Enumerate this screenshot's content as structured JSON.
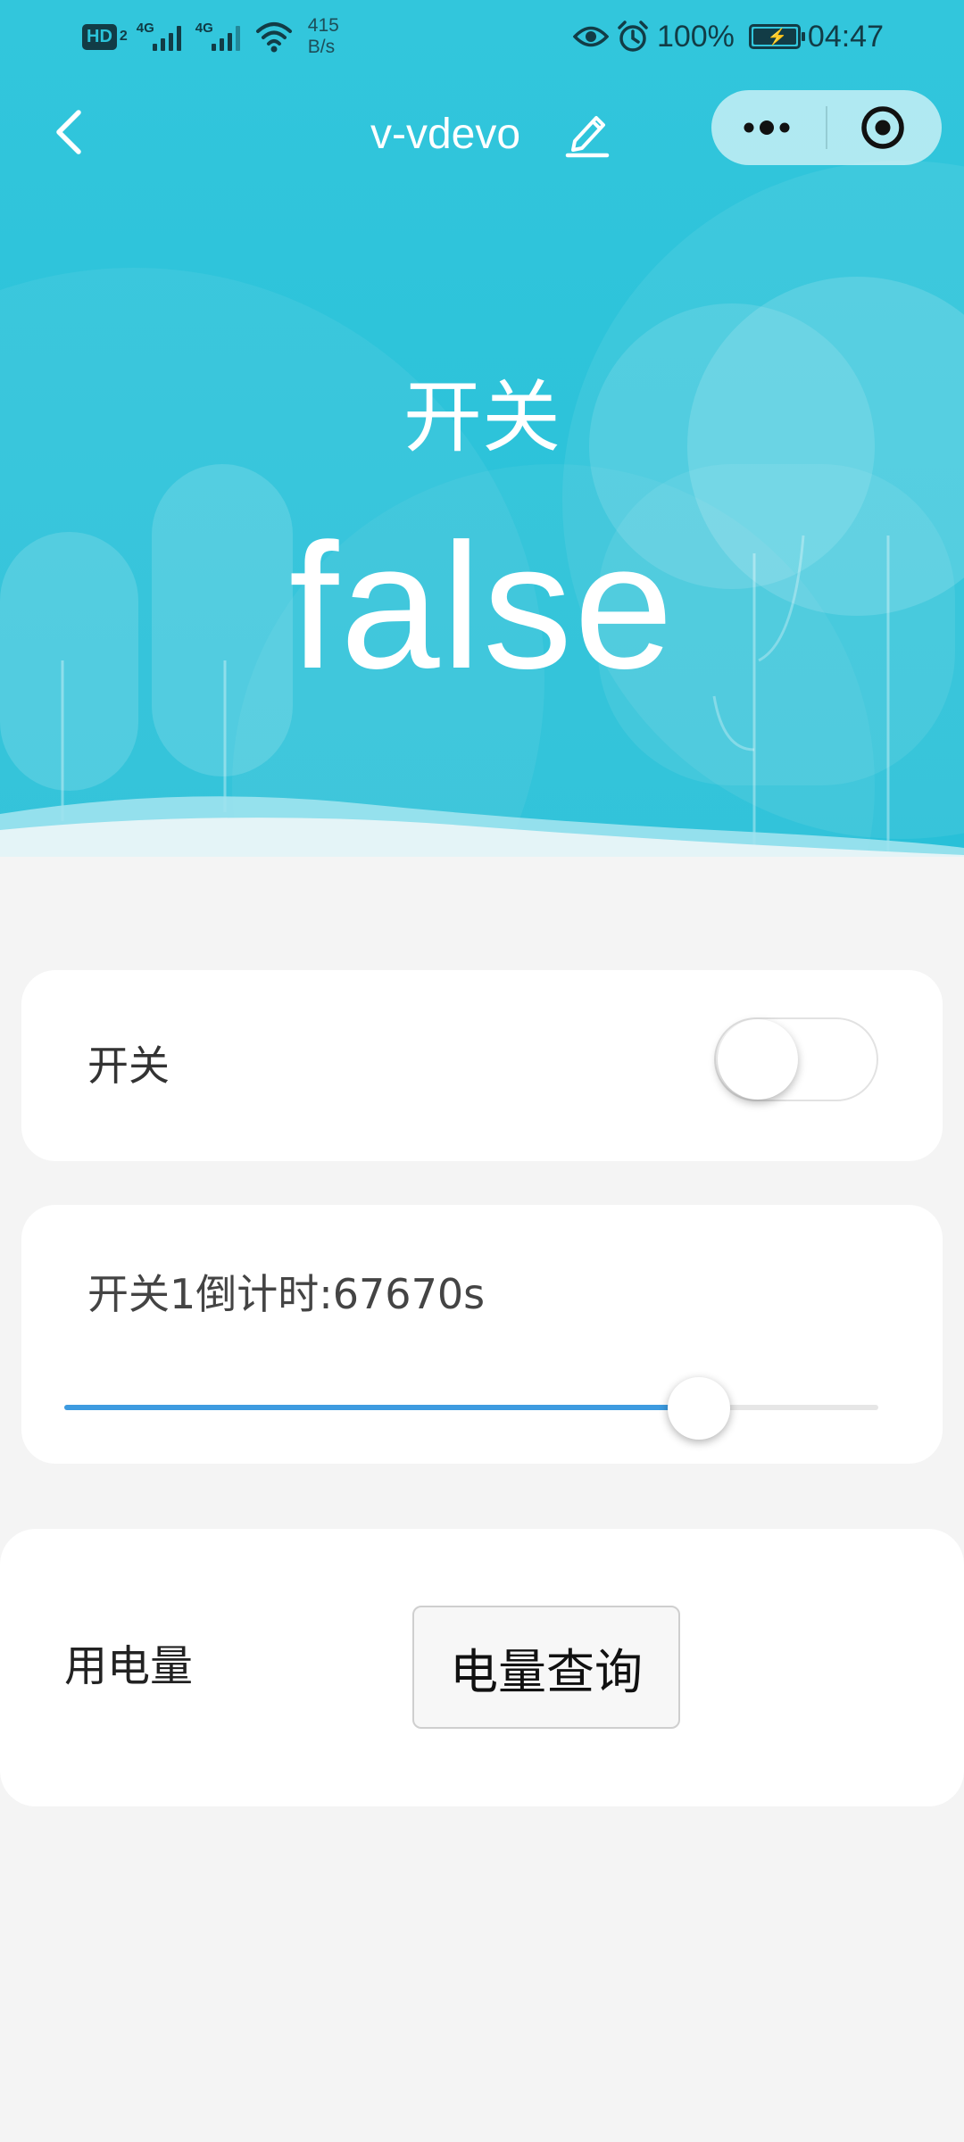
{
  "status_bar": {
    "network_badge": "HD",
    "network_badge_sub": "2",
    "signal_1_label": "4G",
    "signal_2_label": "4G",
    "speed_value": "415",
    "speed_unit": "B/s",
    "battery_percent": "100%",
    "time": "04:47"
  },
  "nav": {
    "title": "v-vdevo"
  },
  "hero": {
    "label": "开关",
    "value": "false"
  },
  "switch_card": {
    "label": "开关",
    "checked": false
  },
  "timer_card": {
    "label": "开关1倒计时:67670s",
    "slider_fraction": 0.78
  },
  "power_card": {
    "label": "用电量",
    "button_label": "电量查询"
  },
  "colors": {
    "hero_primary": "#29c2d9",
    "slider_active": "#3d9be0",
    "page_background": "#f4f4f4"
  },
  "icons": {
    "back": "chevron-left-icon",
    "edit": "pencil-icon",
    "more": "more-dots-icon",
    "close": "target-circle-icon"
  }
}
